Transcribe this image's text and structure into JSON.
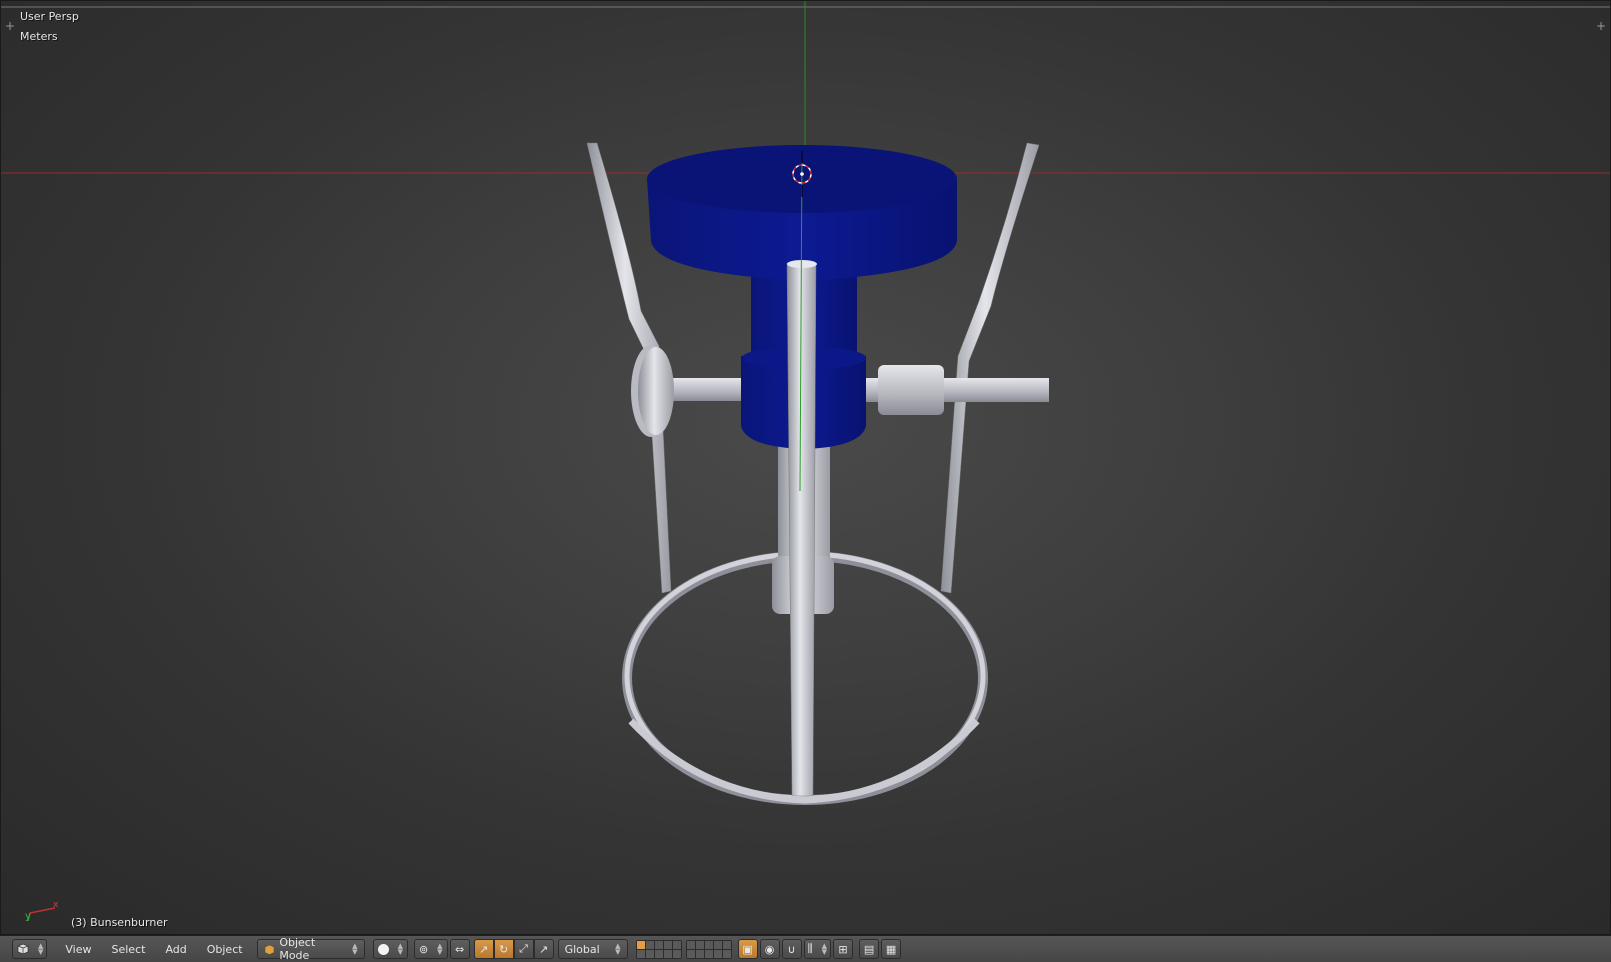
{
  "viewport": {
    "view_label": "User Persp",
    "units_label": "Meters",
    "object_label": "(3) Bunsenburner",
    "axis_labels": {
      "x": "x",
      "y": "y"
    }
  },
  "header": {
    "editor_type_icon": "3d-view-icon",
    "menus": [
      "View",
      "Select",
      "Add",
      "Object"
    ],
    "mode": "Object Mode",
    "transform_orientation": "Global"
  },
  "colors": {
    "burner_head": "#0a1480",
    "metal": "#c7c8cf",
    "x_axis": "#a02020",
    "y_axis": "#208020",
    "active_button": "#d08a3a"
  }
}
